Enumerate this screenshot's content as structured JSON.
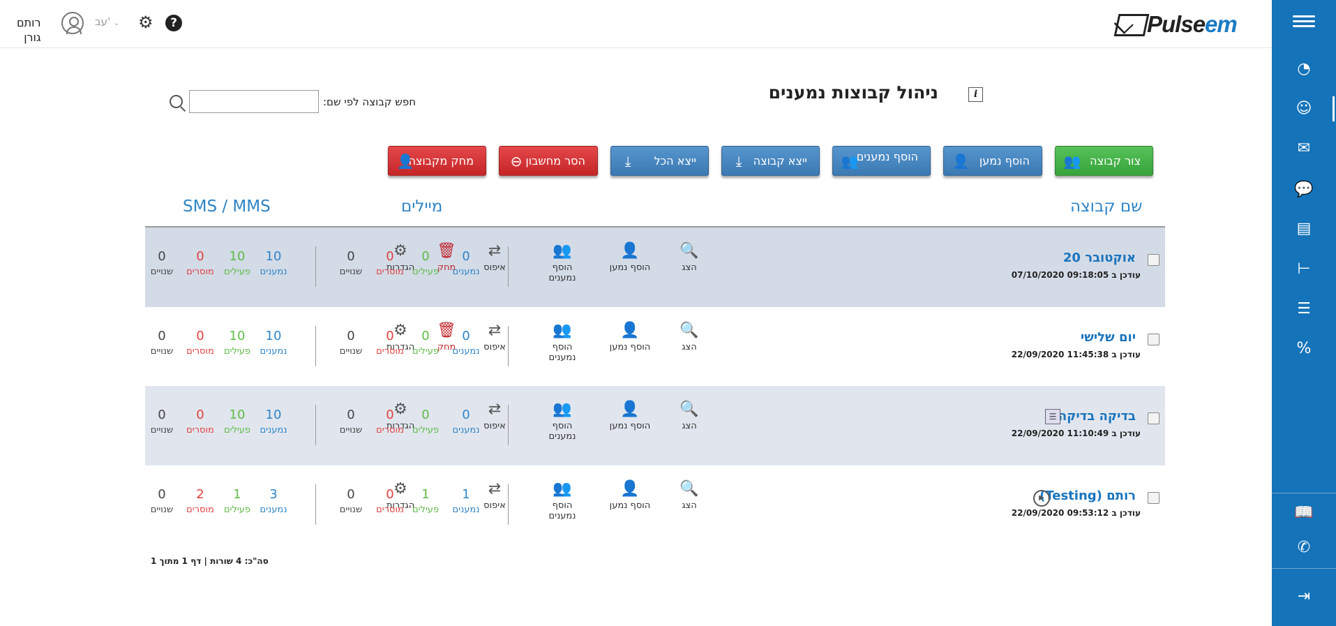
{
  "header": {
    "user_name": "רותם\nגורן",
    "lang": "עב'",
    "logo_text_main": "Pulse",
    "logo_text_accent": "em"
  },
  "page": {
    "title": "ניהול קבוצות נמענים",
    "search_label": "חפש קבוצה לפי שם:",
    "search_value": ""
  },
  "buttons": {
    "create_group": "צור קבוצה",
    "add_recipient": "הוסף נמען",
    "add_recipients": "הוסף נמענים",
    "export_group": "ייצא קבוצה",
    "export_all": "ייצא הכל",
    "remove_from_account": "הסר מחשבון",
    "delete_group": "מחק מקבוצה"
  },
  "columns": {
    "group_name": "שם קבוצה",
    "emails": "מיילים",
    "sms": "SMS / MMS"
  },
  "labels": {
    "updated_at": "עודכן ב",
    "show": "הצג",
    "add_recipient": "הוסף נמען",
    "add_recipients": "הוסף נמענים",
    "reset": "איפוס",
    "delete": "מחק",
    "settings": "הגדרות",
    "recipients": "נמענים",
    "active": "פעילים",
    "removed": "מוסרים",
    "changes": "שנויים"
  },
  "groups": [
    {
      "name": "אוקטובר 20",
      "updated": "09:18:05 07/10/2020",
      "email": {
        "recipients": "0",
        "active": "0",
        "removed": "0",
        "changes": "0"
      },
      "sms": {
        "recipients": "10",
        "active": "10",
        "removed": "0",
        "changes": "0"
      }
    },
    {
      "name": "יום שלישי",
      "updated": "11:45:38 22/09/2020",
      "email": {
        "recipients": "0",
        "active": "0",
        "removed": "0",
        "changes": "0"
      },
      "sms": {
        "recipients": "10",
        "active": "10",
        "removed": "0",
        "changes": "0"
      }
    },
    {
      "name": "בדיקה בדיקה",
      "updated": "11:10:49 22/09/2020",
      "email": {
        "recipients": "0",
        "active": "0",
        "removed": "0",
        "changes": "0"
      },
      "sms": {
        "recipients": "10",
        "active": "10",
        "removed": "0",
        "changes": "0"
      }
    },
    {
      "name": "רותם (Testing)",
      "updated": "09:53:12 22/09/2020",
      "email": {
        "recipients": "1",
        "active": "1",
        "removed": "0",
        "changes": "0"
      },
      "sms": {
        "recipients": "3",
        "active": "1",
        "removed": "2",
        "changes": "0"
      }
    }
  ],
  "footer": {
    "summary": "סה\"כ: 4 שורות  |  דף 1 מתוך 1"
  },
  "colors": {
    "sidebar": "#1473b9",
    "green_button": "#3fa843",
    "blue_button": "#4584c0",
    "red_button": "#d5393b",
    "link_blue": "#2f84c6"
  }
}
